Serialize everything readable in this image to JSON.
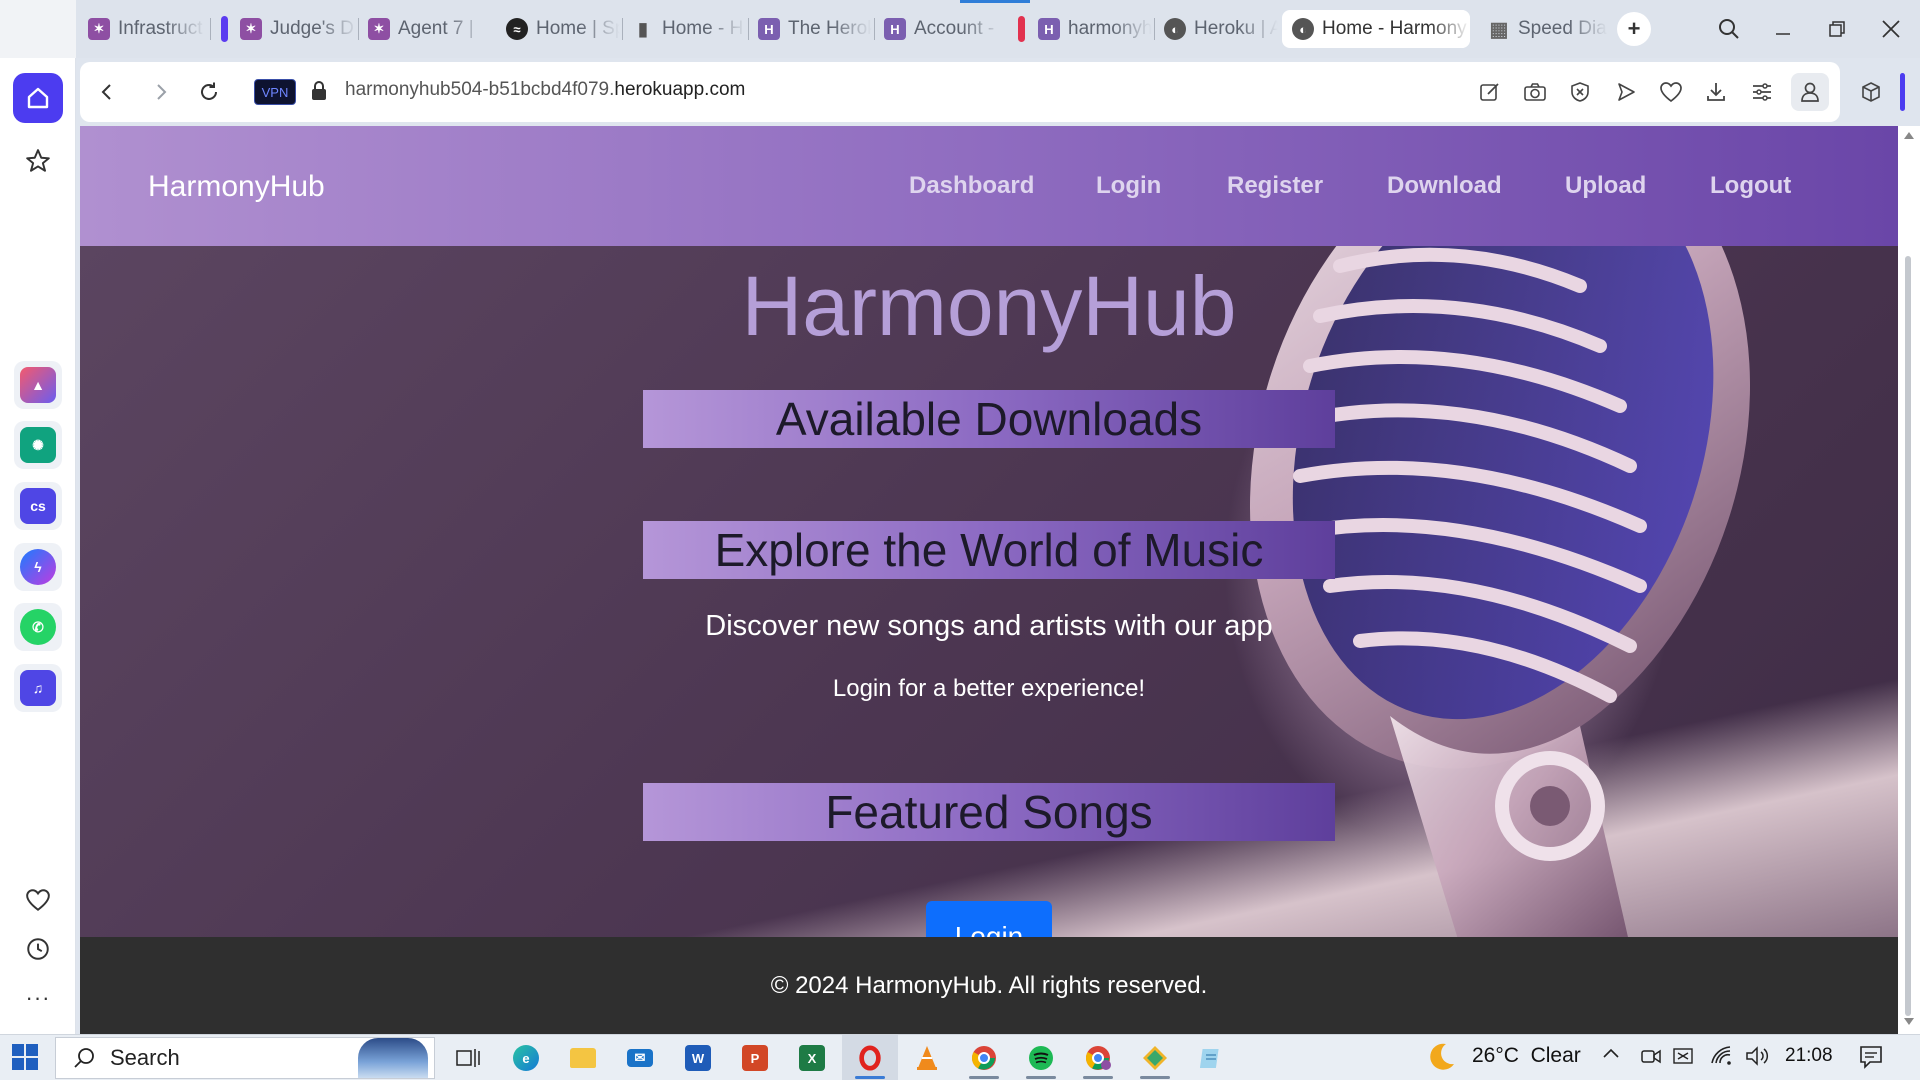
{
  "browser": {
    "tabs": [
      {
        "title": "Infrastruct",
        "favicon": "judge-icon"
      },
      {
        "title": "Judge's D",
        "favicon": "judge-icon"
      },
      {
        "title": "Agent 7 |",
        "favicon": "judge-icon"
      },
      {
        "title": "Home | Sp",
        "favicon": "spotify-icon"
      },
      {
        "title": "Home - H",
        "favicon": "document-icon"
      },
      {
        "title": "The Herok",
        "favicon": "heroku-icon"
      },
      {
        "title": "Account -",
        "favicon": "heroku-icon"
      },
      {
        "title": "harmonyh",
        "favicon": "heroku-icon"
      },
      {
        "title": "Heroku | A",
        "favicon": "globe-icon"
      },
      {
        "title": "Home - Harmony",
        "favicon": "globe-icon",
        "active": true
      },
      {
        "title": "Speed Dia",
        "favicon": "grid-icon"
      }
    ],
    "url": {
      "subdomain": "harmonyhub504-b51bcbd4f079.",
      "domain": "herokuapp.com"
    },
    "vpn_label": "VPN"
  },
  "app": {
    "brand": "HarmonyHub",
    "nav": [
      "Dashboard",
      "Login",
      "Register",
      "Download",
      "Upload",
      "Logout"
    ],
    "hero_title": "HarmonyHub",
    "sections": {
      "downloads": "Available Downloads",
      "explore": "Explore the World of Music",
      "featured": "Featured Songs"
    },
    "discover_text": "Discover new songs and artists with our app",
    "login_prompt": "Login for a better experience!",
    "login_button": "Login",
    "footer": "© 2024 HarmonyHub. All rights reserved."
  },
  "taskbar": {
    "search_label": "Search",
    "weather": "26°C  Clear",
    "time": "21:08"
  },
  "colors": {
    "nav_gradient_start": "#b090d0",
    "nav_gradient_end": "#6a46a8",
    "login_button": "#0d6efd",
    "footer_bg": "#2f2f2f",
    "opera_red": "#e0231e",
    "sidebar_home": "#4c3cf0"
  }
}
